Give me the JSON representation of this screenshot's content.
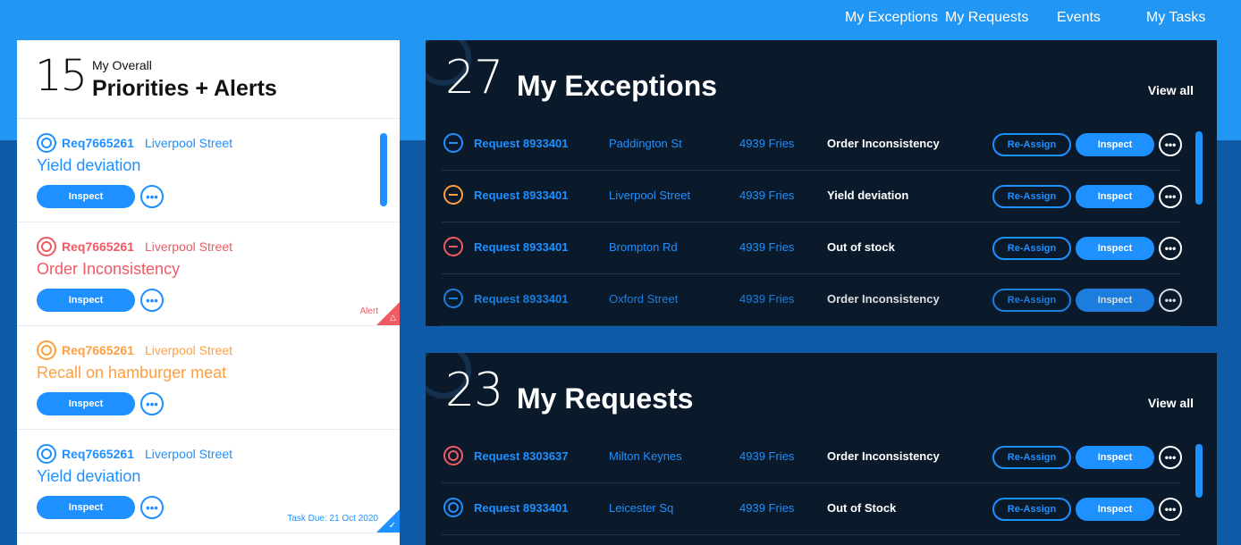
{
  "nav": {
    "items": [
      "My Exceptions",
      "My Requests",
      "Events",
      "My Tasks"
    ]
  },
  "priorities": {
    "count": "15",
    "subtitle": "My Overall",
    "title": "Priorities + Alerts",
    "cards": [
      {
        "req": "Req7665261",
        "location": "Liverpool Street",
        "title": "Yield deviation",
        "button": "Inspect",
        "color": "blue",
        "footer": ""
      },
      {
        "req": "Req7665261",
        "location": "Liverpool Street",
        "title": "Order Inconsistency",
        "button": "Inspect",
        "color": "red",
        "footer": "Alert"
      },
      {
        "req": "Req7665261",
        "location": "Liverpool Street",
        "title": "Recall on hamburger meat",
        "button": "Inspect",
        "color": "orange",
        "footer": ""
      },
      {
        "req": "Req7665261",
        "location": "Liverpool Street",
        "title": "Yield deviation",
        "button": "Inspect",
        "color": "blue",
        "footer": "Task Due: 21 Oct 2020"
      }
    ]
  },
  "exceptions": {
    "count": "27",
    "title": "My Exceptions",
    "view_all": "View all",
    "rows": [
      {
        "request": "Request 8933401",
        "location": "Paddington St",
        "store": "4939 Fries",
        "issue": "Order Inconsistency",
        "reassign": "Re-Assign",
        "inspect": "Inspect",
        "color": "blue"
      },
      {
        "request": "Request 8933401",
        "location": "Liverpool Street",
        "store": "4939 Fries",
        "issue": "Yield deviation",
        "reassign": "Re-Assign",
        "inspect": "Inspect",
        "color": "orange"
      },
      {
        "request": "Request 8933401",
        "location": "Brompton Rd",
        "store": "4939 Fries",
        "issue": "Out of stock",
        "reassign": "Re-Assign",
        "inspect": "Inspect",
        "color": "red"
      },
      {
        "request": "Request 8933401",
        "location": "Oxford Street",
        "store": "4939 Fries",
        "issue": "Order Inconsistency",
        "reassign": "Re-Assign",
        "inspect": "Inspect",
        "color": "blue"
      }
    ]
  },
  "requests": {
    "count": "23",
    "title": "My Requests",
    "view_all": "View all",
    "rows": [
      {
        "request": "Request 8303637",
        "location": "Milton Keynes",
        "store": "4939 Fries",
        "issue": "Order Inconsistency",
        "reassign": "Re-Assign",
        "inspect": "Inspect",
        "color": "red"
      },
      {
        "request": "Request 8933401",
        "location": "Leicester Sq",
        "store": "4939 Fries",
        "issue": "Out of Stock",
        "reassign": "Re-Assign",
        "inspect": "Inspect",
        "color": "blue"
      }
    ]
  },
  "colors": {
    "blue": "#1e90ff",
    "red": "#f05a64",
    "orange": "#ff9f40",
    "panel_bg": "#0b1a2b"
  }
}
